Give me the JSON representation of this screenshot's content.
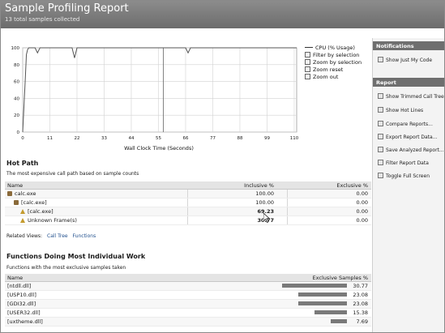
{
  "header": {
    "title": "Sample Profiling Report",
    "subtitle": "13 total samples collected"
  },
  "chart_data": {
    "type": "line",
    "xlabel": "Wall Clock Time (Seconds)",
    "ylabel": "",
    "x_ticks": [
      "0",
      "11",
      "22",
      "33",
      "44",
      "55",
      "66",
      "77",
      "88",
      "99",
      "110"
    ],
    "y_ticks": [
      "0",
      "20",
      "40",
      "60",
      "80",
      "100"
    ],
    "xlim": [
      0,
      111
    ],
    "ylim": [
      0,
      100
    ],
    "grid": true,
    "legend_position": "right",
    "series": [
      {
        "name": "CPU (% Usage)",
        "x": [
          0,
          0.5,
          1,
          1.5,
          2,
          2.5,
          3,
          4,
          5,
          6,
          7,
          8,
          9,
          10,
          11,
          12,
          13,
          14,
          15,
          16,
          17,
          18,
          19,
          20,
          21,
          22,
          23,
          24,
          25,
          26,
          27,
          28,
          29,
          30,
          31,
          32,
          33,
          34,
          35,
          36,
          37,
          38,
          39,
          40,
          41,
          42,
          43,
          44,
          45,
          46,
          47,
          48,
          49,
          50,
          51,
          52,
          53,
          54,
          55,
          56,
          57,
          58,
          59,
          60,
          61,
          62,
          63,
          64,
          65,
          66,
          67,
          68,
          69,
          70,
          71,
          72,
          73,
          74,
          75,
          76,
          77,
          78,
          79,
          80,
          81,
          82,
          83,
          84,
          85,
          86,
          87,
          88,
          89,
          90,
          91,
          92,
          93,
          94,
          95,
          96,
          97,
          98,
          99,
          100,
          101,
          102,
          103,
          104,
          105,
          106,
          107,
          108,
          109,
          110,
          111
        ],
        "values": [
          0,
          30,
          60,
          92,
          98,
          100,
          100,
          100,
          100,
          94,
          100,
          100,
          100,
          100,
          100,
          100,
          100,
          100,
          100,
          100,
          100,
          100,
          100,
          100,
          88,
          100,
          100,
          100,
          100,
          100,
          100,
          100,
          100,
          100,
          100,
          100,
          100,
          100,
          100,
          100,
          100,
          100,
          100,
          100,
          100,
          100,
          100,
          100,
          100,
          100,
          100,
          100,
          100,
          100,
          100,
          100,
          100,
          100,
          100,
          100,
          100,
          100,
          100,
          100,
          100,
          100,
          100,
          100,
          100,
          100,
          94,
          100,
          100,
          100,
          100,
          100,
          100,
          100,
          100,
          100,
          100,
          100,
          100,
          100,
          100,
          100,
          100,
          100,
          100,
          100,
          100,
          100,
          100,
          100,
          100,
          100,
          100,
          100,
          100,
          100,
          100,
          100,
          100,
          100,
          100,
          100,
          100,
          100,
          100,
          100,
          100,
          100,
          100,
          100,
          100
        ]
      }
    ]
  },
  "chart_commands": [
    {
      "label": "CPU (% Usage)",
      "icon": "legend-line-icon"
    },
    {
      "label": "Filter by selection",
      "icon": "filter-icon"
    },
    {
      "label": "Zoom by selection",
      "icon": "zoom-selection-icon"
    },
    {
      "label": "Zoom reset",
      "icon": "zoom-reset-icon"
    },
    {
      "label": "Zoom out",
      "icon": "zoom-out-icon"
    }
  ],
  "hot_path": {
    "title": "Hot Path",
    "description": "The most expensive call path based on sample counts",
    "columns": [
      "Name",
      "Inclusive %",
      "Exclusive %"
    ],
    "rows": [
      {
        "name": "calc.exe",
        "inclusive": "100.00",
        "exclusive": "0.00",
        "bold": false
      },
      {
        "name": "[calc.exe]",
        "inclusive": "100.00",
        "exclusive": "0.00",
        "bold": false
      },
      {
        "name": "[calc.exe]",
        "inclusive": "69.23",
        "exclusive": "0.00",
        "bold": true
      },
      {
        "name": "Unknown Frame(s)",
        "inclusive": "30.77",
        "exclusive": "0.00",
        "bold": true
      }
    ],
    "related_label": "Related Views:",
    "related_links": [
      "Call Tree",
      "Functions"
    ]
  },
  "functions": {
    "title": "Functions Doing Most Individual Work",
    "description": "Functions with the most exclusive samples taken",
    "columns": [
      "Name",
      "Exclusive Samples %"
    ],
    "rows": [
      {
        "name": "[ntdll.dll]",
        "value": "30.77",
        "fraction": 0.3077
      },
      {
        "name": "[USP10.dll]",
        "value": "23.08",
        "fraction": 0.2308
      },
      {
        "name": "[GDI32.dll]",
        "value": "23.08",
        "fraction": 0.2308
      },
      {
        "name": "[USER32.dll]",
        "value": "15.38",
        "fraction": 0.1538
      },
      {
        "name": "[uxtheme.dll]",
        "value": "7.69",
        "fraction": 0.0769
      }
    ]
  },
  "side_panel": {
    "notifications_title": "Notifications",
    "notifications_items": [
      {
        "label": "Show Just My Code",
        "icon": "just-my-code-icon"
      }
    ],
    "report_title": "Report",
    "report_items": [
      {
        "label": "Show Trimmed Call Tree",
        "icon": "call-tree-icon"
      },
      {
        "label": "Show Hot Lines",
        "icon": "hot-lines-icon"
      },
      {
        "label": "Compare Reports...",
        "icon": "compare-icon"
      },
      {
        "label": "Export Report Data...",
        "icon": "export-icon"
      },
      {
        "label": "Save Analyzed Report...",
        "icon": "save-icon"
      },
      {
        "label": "Filter Report Data",
        "icon": "filter-icon"
      },
      {
        "label": "Toggle Full Screen",
        "icon": "fullscreen-icon"
      }
    ]
  },
  "colors": {
    "header_bg": "#7a7a7a",
    "cpu_line": "#555555",
    "bar_fill": "#7a7a7a"
  }
}
